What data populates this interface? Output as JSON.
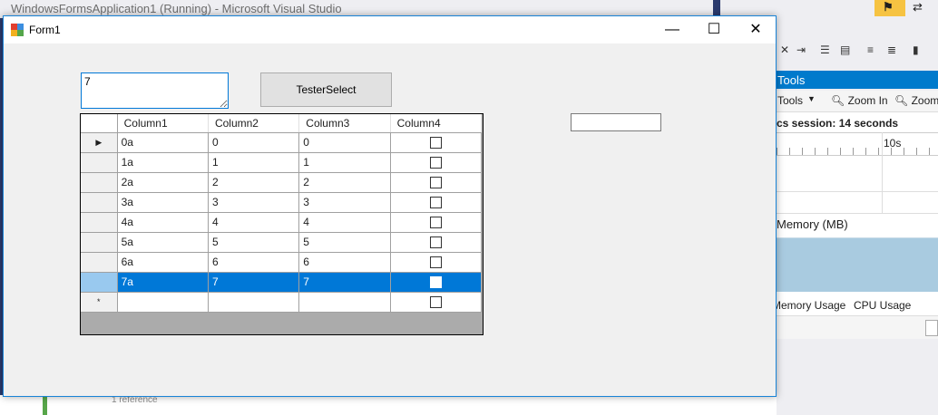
{
  "vs": {
    "title": "WindowsFormsApplication1 (Running) - Microsoft Visual Studio",
    "diagnostics": {
      "header": "Tools",
      "tools_label": "Tools",
      "zoom_in": "Zoom In",
      "zoom_out": "Zoom",
      "session": "cs session: 14 seconds",
      "ruler_label": "10s",
      "memory_label": "Memory (MB)",
      "tab_memory": "Memory Usage",
      "tab_cpu": "CPU Usage"
    },
    "editor_ref": "1 reference"
  },
  "form1": {
    "title": "Form1",
    "text_input_value": "7",
    "button_label": "TesterSelect",
    "right_input_value": "",
    "grid": {
      "columns": [
        "Column1",
        "Column2",
        "Column3",
        "Column4"
      ],
      "rows": [
        {
          "c1": "0a",
          "c2": "0",
          "c3": "0",
          "checked": false
        },
        {
          "c1": "1a",
          "c2": "1",
          "c3": "1",
          "checked": false
        },
        {
          "c1": "2a",
          "c2": "2",
          "c3": "2",
          "checked": false
        },
        {
          "c1": "3a",
          "c2": "3",
          "c3": "3",
          "checked": false
        },
        {
          "c1": "4a",
          "c2": "4",
          "c3": "4",
          "checked": false
        },
        {
          "c1": "5a",
          "c2": "5",
          "c3": "5",
          "checked": false
        },
        {
          "c1": "6a",
          "c2": "6",
          "c3": "6",
          "checked": false
        },
        {
          "c1": "7a",
          "c2": "7",
          "c3": "7",
          "checked": false
        }
      ],
      "selected_row_index": 7,
      "current_row_glyph": "▶",
      "new_row_glyph": "*"
    }
  },
  "colors": {
    "selection": "#0078d7",
    "window_border": "#1883d7",
    "vs_accent": "#007acc",
    "notification": "#f6c342"
  }
}
